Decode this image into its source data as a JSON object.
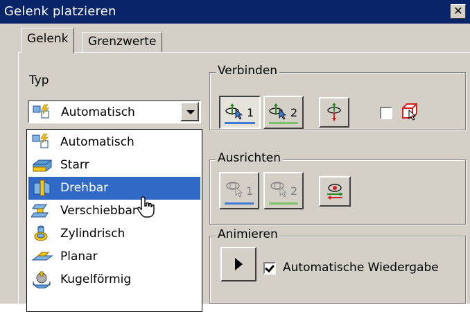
{
  "window": {
    "title": "Gelenk platzieren",
    "close_glyph": "✕"
  },
  "tabs": [
    {
      "label": "Gelenk",
      "active": true
    },
    {
      "label": "Grenzwerte",
      "active": false
    }
  ],
  "typ": {
    "label": "Typ",
    "selected": "Automatisch",
    "selected_icon": "automatic-joint-icon",
    "options": [
      {
        "label": "Automatisch",
        "icon": "automatic-joint-icon",
        "highlighted": false
      },
      {
        "label": "Starr",
        "icon": "rigid-joint-icon",
        "highlighted": false
      },
      {
        "label": "Drehbar",
        "icon": "rotational-joint-icon",
        "highlighted": true
      },
      {
        "label": "Verschiebbar",
        "icon": "slider-joint-icon",
        "highlighted": false
      },
      {
        "label": "Zylindrisch",
        "icon": "cylindrical-joint-icon",
        "highlighted": false
      },
      {
        "label": "Planar",
        "icon": "planar-joint-icon",
        "highlighted": false
      },
      {
        "label": "Kugelförmig",
        "icon": "ball-joint-icon",
        "highlighted": false
      }
    ]
  },
  "verbinden": {
    "title": "Verbinden",
    "select1_num": "1",
    "select2_num": "2",
    "select1_color": "#3a7bd5",
    "select2_color": "#7cc46a",
    "select1_icon": "select-origin-1-icon",
    "select2_icon": "select-origin-2-icon",
    "flip_icon": "flip-component-icon",
    "lock_icon": "lock-component-icon",
    "checkbox_checked": false
  },
  "ausrichten": {
    "title": "Ausrichten",
    "align1_num": "1",
    "align2_num": "2",
    "align1_color": "#3a7bd5",
    "align2_color": "#7cc46a",
    "align1_icon": "align-1-icon",
    "align2_icon": "align-2-icon",
    "invert_icon": "invert-alignment-icon"
  },
  "animieren": {
    "title": "Animieren",
    "play_icon": "play-icon",
    "autoplay_label": "Automatische Wiedergabe",
    "autoplay_checked": true
  },
  "colors": {
    "titlebar": "#0a246a",
    "dialog_bg": "#d4d0c8",
    "selection": "#3169c6"
  }
}
